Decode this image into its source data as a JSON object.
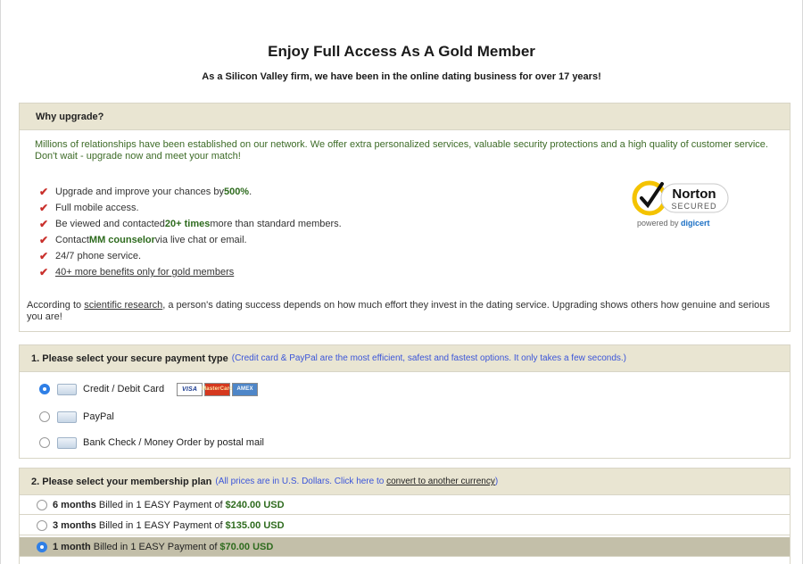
{
  "header": {
    "title": "Enjoy Full Access As A Gold Member",
    "subtitle": "As a Silicon Valley firm, we have been in the online dating business for over 17 years!"
  },
  "why": {
    "heading": "Why upgrade?",
    "intro": "Millions of relationships have been established on our network. We offer extra personalized services, valuable security protections and a high quality of customer service. Don't wait - upgrade now and meet your match!",
    "benefits": [
      {
        "pre": "Upgrade and improve your chances by ",
        "bold": "500%",
        "post": "."
      },
      {
        "pre": "Full mobile access.",
        "bold": "",
        "post": ""
      },
      {
        "pre": "Be viewed and contacted ",
        "bold": "20+ times",
        "post": " more than standard members."
      },
      {
        "pre": "Contact ",
        "bold": "MM counselor",
        "post": " via live chat or email."
      },
      {
        "pre": "24/7 phone service.",
        "bold": "",
        "post": ""
      },
      {
        "pre": "",
        "bold": "",
        "post": "",
        "link": "40+ more benefits only for gold members"
      }
    ],
    "badge": {
      "name": "Norton",
      "sub": "SECURED",
      "powered": "powered by ",
      "brand": "digicert"
    },
    "research_pre": "According to ",
    "research_link": "scientific research",
    "research_post": ", a person's dating success depends on how much effort they invest in the dating service. Upgrading shows others how genuine and serious you are!"
  },
  "payment": {
    "heading": "1. Please select your secure payment type",
    "hint": "(Credit card & PayPal are the most efficient, safest and fastest options. It only takes a few seconds.)",
    "options": [
      {
        "label": "Credit / Debit Card",
        "selected": true
      },
      {
        "label": "PayPal",
        "selected": false
      },
      {
        "label": "Bank Check / Money Order by postal mail",
        "selected": false
      }
    ],
    "cards": [
      "VISA",
      "MasterCard",
      "AMEX"
    ]
  },
  "plan": {
    "heading": "2. Please select your membership plan",
    "hint_pre": "(All prices are in U.S. Dollars. Click here to ",
    "hint_link": "convert to another currency",
    "hint_post": ")",
    "options": [
      {
        "duration": "6 months",
        "text": "Billed in 1 EASY Payment of",
        "price": "$240.00 USD",
        "selected": false
      },
      {
        "duration": "3 months",
        "text": "Billed in 1 EASY Payment of",
        "price": "$135.00 USD",
        "selected": false
      },
      {
        "duration": "1 month",
        "text": "Billed in 1 EASY Payment of",
        "price": "$70.00 USD",
        "selected": true
      }
    ]
  },
  "colors": {
    "panel_header": "#e9e5d2",
    "selected_row": "#c3bfa9",
    "accent_green": "#2e6b1e",
    "hint_blue": "#3b55d9",
    "check_red": "#c9302c"
  }
}
